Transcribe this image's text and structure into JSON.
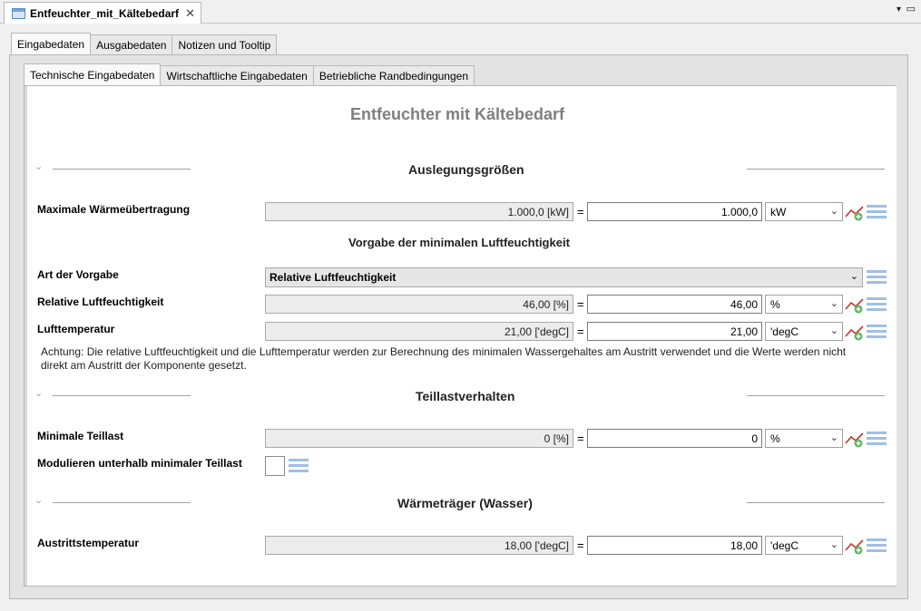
{
  "editor": {
    "tab_title": "Entfeuchter_mit_Kältebedarf",
    "close_glyph": "✕",
    "menu_glyph": "▾",
    "minmax_glyph": "▭"
  },
  "top_tabs": [
    "Eingabedaten",
    "Ausgabedaten",
    "Notizen und Tooltip"
  ],
  "sub_tabs": [
    "Technische Eingabedaten",
    "Wirtschaftliche Eingabedaten",
    "Betriebliche Randbedingungen"
  ],
  "form": {
    "title": "Entfeuchter mit Kältebedarf",
    "sections": {
      "auslegung": "Auslegungsgrößen",
      "vorgabe": "Vorgabe der minimalen Luftfeuchtigkeit",
      "teillast": "Teillastverhalten",
      "waermetraeger": "Wärmeträger (Wasser)"
    },
    "rows": {
      "max_waerme": {
        "label": "Maximale Wärmeübertragung",
        "readonly": "1.000,0 [kW]",
        "value": "1.000,0",
        "unit": "kW"
      },
      "art_vorgabe": {
        "label": "Art der Vorgabe",
        "selected": "Relative Luftfeuchtigkeit"
      },
      "rel_feuchte": {
        "label": "Relative Luftfeuchtigkeit",
        "readonly": "46,00 [%]",
        "value": "46,00",
        "unit": "%"
      },
      "lufttemp": {
        "label": "Lufttemperatur",
        "readonly": "21,00 ['degC]",
        "value": "21,00",
        "unit": "'degC"
      },
      "min_teillast": {
        "label": "Minimale Teillast",
        "readonly": "0 [%]",
        "value": "0",
        "unit": "%"
      },
      "modulieren": {
        "label": "Modulieren unterhalb minimaler Teillast"
      },
      "austritt": {
        "label": "Austrittstemperatur",
        "readonly": "18,00 ['degC]",
        "value": "18,00",
        "unit": "'degC"
      }
    },
    "note_line1": "Achtung: Die relative Luftfeuchtigkeit und die Lufttemperatur werden zur Berechnung des minimalen Wassergehaltes am Austritt verwendet und die Werte werden nicht",
    "note_line2": "direkt am Austritt der Komponente gesetzt.",
    "equals": "=",
    "chevron": "⌄",
    "collapse": "⌄"
  }
}
